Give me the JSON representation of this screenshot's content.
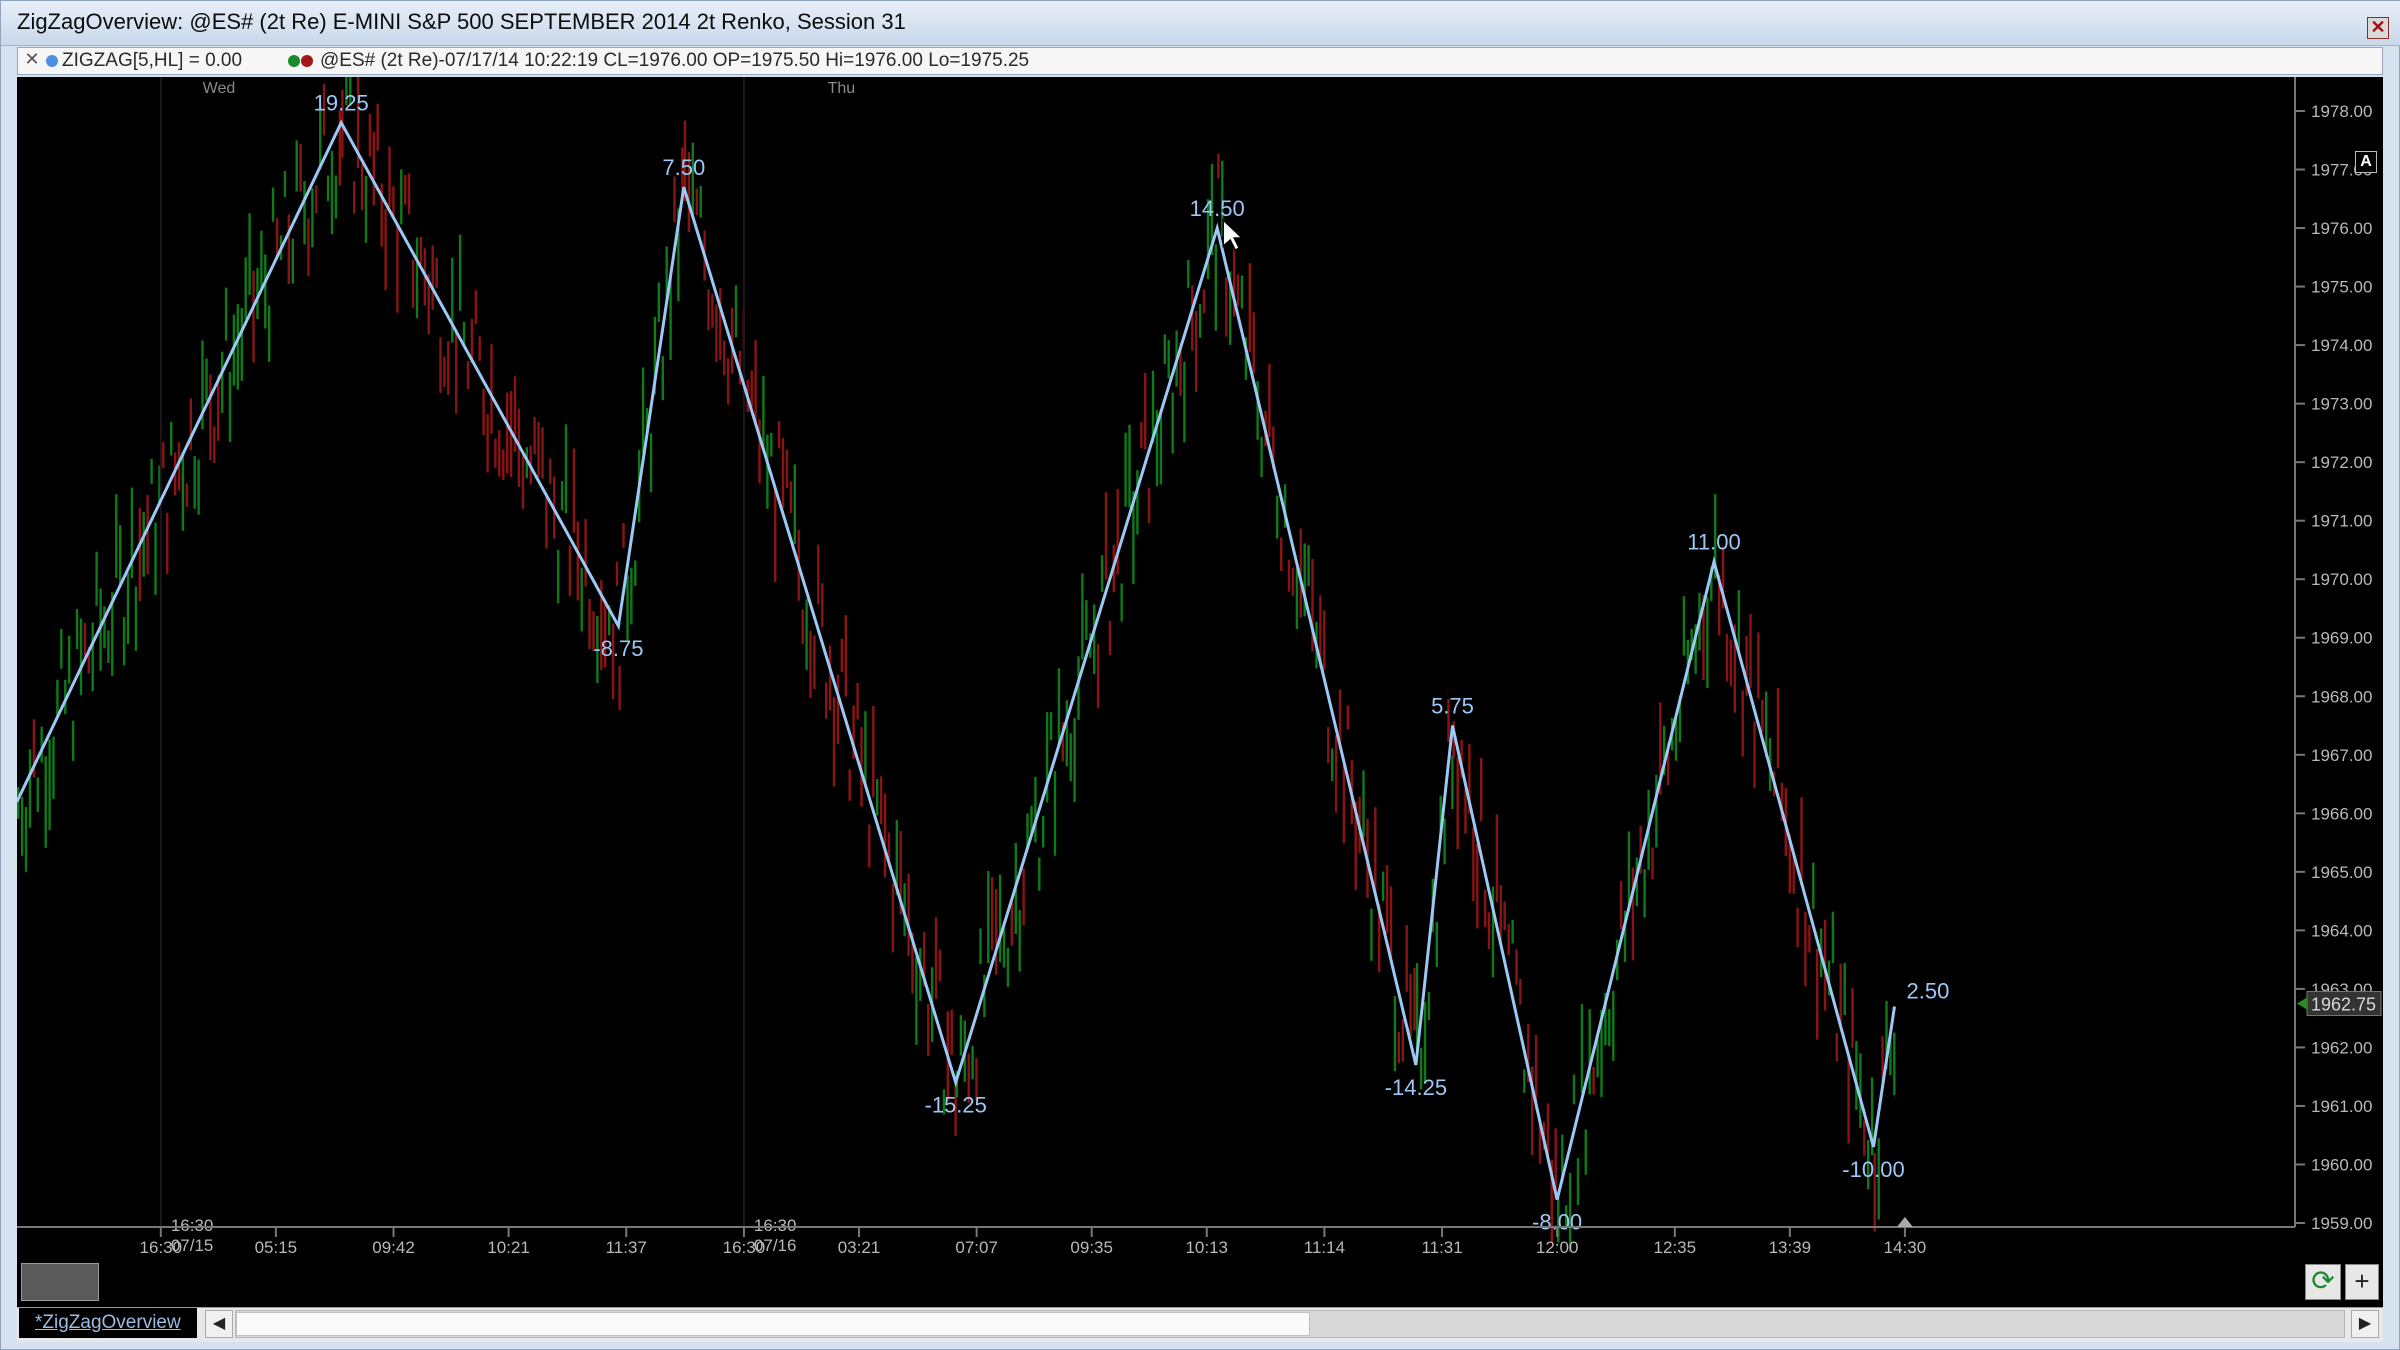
{
  "window": {
    "title": "ZigZagOverview: @ES# (2t Re) E-MINI S&P 500 SEPTEMBER 2014 2t Renko, Session 31",
    "close_glyph": "✕"
  },
  "infobar": {
    "close_glyph": "✕",
    "indicator_text": "ZIGZAG[5,HL] = 0.00",
    "symbol_text": "@ES# (2t Re)-07/17/14 10:22:19 CL=1976.00 OP=1975.50 Hi=1976.00 Lo=1975.25",
    "indicator_color": "#4f8fe0",
    "up_color": "#1a8a2a",
    "down_color": "#a01818"
  },
  "toolbar": {
    "refresh_icon": "refresh-icon",
    "refresh_glyph": "⟳",
    "add_glyph": "+",
    "auto_label": "A"
  },
  "tabs": [
    {
      "label": "*ZigZagOverview"
    }
  ],
  "scroll": {
    "left_glyph": "◀",
    "right_glyph": "▶"
  },
  "chart_data": {
    "type": "line",
    "title": "",
    "xlabel": "",
    "ylabel": "",
    "ylim": [
      1958.5,
      1978.5
    ],
    "y_ticks": [
      1959,
      1960,
      1961,
      1962,
      1963,
      1964,
      1965,
      1966,
      1967,
      1968,
      1969,
      1970,
      1971,
      1972,
      1973,
      1974,
      1975,
      1976,
      1977,
      1978
    ],
    "y_tick_labels": [
      "1959.00",
      "1960.00",
      "1961.00",
      "1962.00",
      "1963.00",
      "1964.00",
      "1965.00",
      "1966.00",
      "1967.00",
      "1968.00",
      "1969.00",
      "1970.00",
      "1971.00",
      "1972.00",
      "1973.00",
      "1974.00",
      "1975.00",
      "1976.00",
      "1977.00",
      "1978.00"
    ],
    "last_price_label": "1962.75",
    "last_price": 1962.75,
    "x_range": [
      0,
      1698
    ],
    "x_ticks": [
      {
        "bar": 110,
        "label": "16:30"
      },
      {
        "bar": 198,
        "label": "05:15"
      },
      {
        "bar": 288,
        "label": "09:42"
      },
      {
        "bar": 376,
        "label": "10:21"
      },
      {
        "bar": 466,
        "label": "11:37"
      },
      {
        "bar": 556,
        "label": "16:30"
      },
      {
        "bar": 644,
        "label": "03:21"
      },
      {
        "bar": 734,
        "label": "07:07"
      },
      {
        "bar": 822,
        "label": "09:35"
      },
      {
        "bar": 910,
        "label": "10:13"
      },
      {
        "bar": 1000,
        "label": "11:14"
      },
      {
        "bar": 1090,
        "label": "11:31"
      },
      {
        "bar": 1178,
        "label": "12:00"
      },
      {
        "bar": 1268,
        "label": "12:35"
      },
      {
        "bar": 1356,
        "label": "13:39"
      },
      {
        "bar": 1444,
        "label": "14:30"
      }
    ],
    "day_labels": [
      {
        "bar": 142,
        "label": "Wed"
      },
      {
        "bar": 620,
        "label": "Thu"
      }
    ],
    "session_markers": [
      {
        "bar": 110,
        "time": "16:30",
        "date": "07/15"
      },
      {
        "bar": 556,
        "time": "16:30",
        "date": "07/16"
      }
    ],
    "series": [
      {
        "type": "zigzag",
        "color": "#9bc8f4",
        "points": [
          {
            "bar": 0,
            "y": 1966.2,
            "label": ""
          },
          {
            "bar": 248,
            "y": 1977.8,
            "label": "19.25"
          },
          {
            "bar": 460,
            "y": 1969.2,
            "label": "-8.75"
          },
          {
            "bar": 510,
            "y": 1976.7,
            "label": "7.50"
          },
          {
            "bar": 718,
            "y": 1961.4,
            "label": "-15.25"
          },
          {
            "bar": 918,
            "y": 1976.0,
            "label": "14.50"
          },
          {
            "bar": 1070,
            "y": 1961.7,
            "label": "-14.25"
          },
          {
            "bar": 1098,
            "y": 1967.5,
            "label": "5.75"
          },
          {
            "bar": 1178,
            "y": 1959.4,
            "label": "-8.00"
          },
          {
            "bar": 1298,
            "y": 1970.3,
            "label": "11.00"
          },
          {
            "bar": 1420,
            "y": 1960.3,
            "label": "-10.00"
          },
          {
            "bar": 1436,
            "y": 1962.7,
            "label": "2.50"
          }
        ]
      }
    ],
    "renko_bars": {
      "colors": {
        "up": "#0f7a1a",
        "down": "#8a1414"
      },
      "brick_size": 0.5
    },
    "grid": false,
    "background": "#000000",
    "axis_text_color": "#b8b8b8",
    "label_color": "#9bc8f4"
  }
}
